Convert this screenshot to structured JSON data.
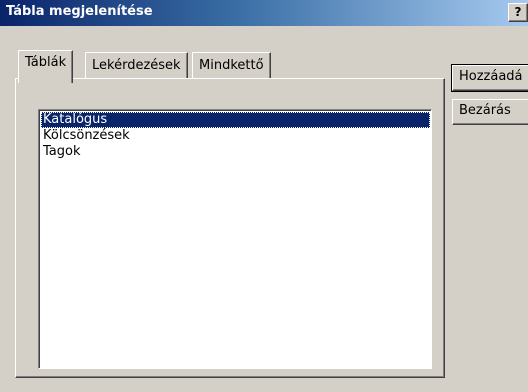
{
  "window": {
    "title": "Tábla megjelenítése",
    "help_label": "?"
  },
  "tabs": [
    {
      "label": "Táblák",
      "active": true
    },
    {
      "label": "Lekérdezések",
      "active": false
    },
    {
      "label": "Mindkettő",
      "active": false
    }
  ],
  "list": {
    "items": [
      "Katalógus",
      "Kölcsönzések",
      "Tagok"
    ],
    "selected": "Katalógus"
  },
  "buttons": {
    "add_label": "Hozzáadá",
    "close_label": "Bezárás"
  }
}
